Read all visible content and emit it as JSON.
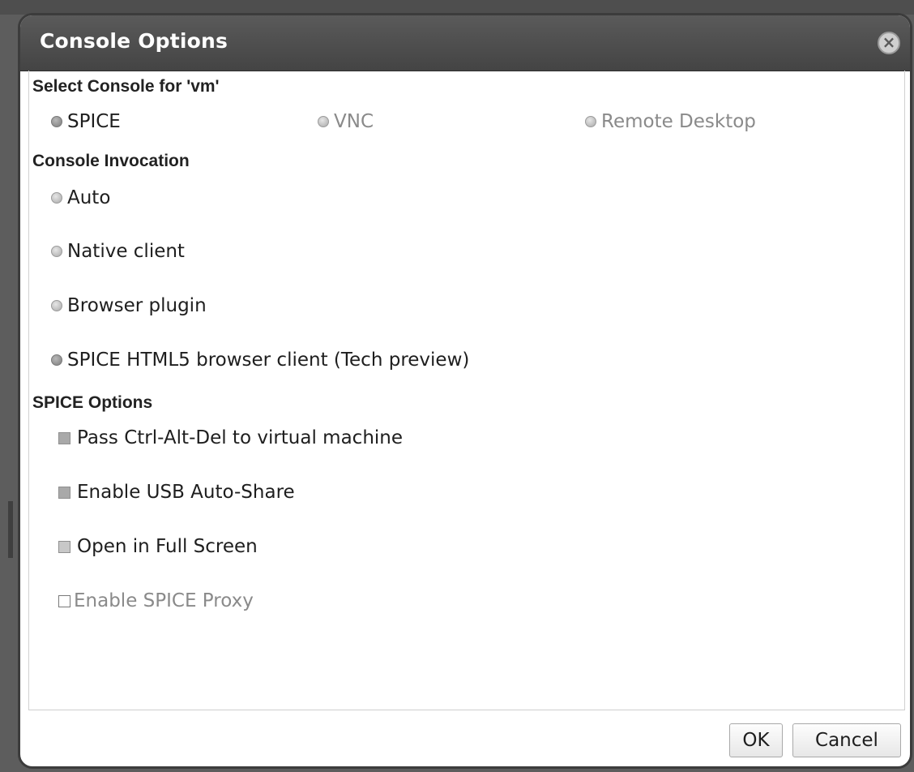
{
  "dialog": {
    "title": "Console Options",
    "close_icon": "close-circle-icon"
  },
  "console_select": {
    "label": "Select Console for 'vm'",
    "options": [
      {
        "label": "SPICE",
        "checked": true,
        "enabled": true
      },
      {
        "label": "VNC",
        "checked": false,
        "enabled": false
      },
      {
        "label": "Remote Desktop",
        "checked": false,
        "enabled": false
      }
    ]
  },
  "invocation": {
    "label": "Console Invocation",
    "options": [
      {
        "label": "Auto",
        "checked": false
      },
      {
        "label": "Native client",
        "checked": false
      },
      {
        "label": "Browser plugin",
        "checked": false
      },
      {
        "label": "SPICE HTML5 browser client (Tech preview)",
        "checked": true
      }
    ]
  },
  "spice_options": {
    "label": "SPICE Options",
    "options": [
      {
        "label": "Pass Ctrl-Alt-Del to virtual machine",
        "checked": true,
        "enabled": true
      },
      {
        "label": "Enable USB Auto-Share",
        "checked": true,
        "enabled": true
      },
      {
        "label": "Open in Full Screen",
        "checked": false,
        "enabled": true
      },
      {
        "label": "Enable SPICE Proxy",
        "checked": false,
        "enabled": false
      }
    ]
  },
  "footer": {
    "ok_label": "OK",
    "cancel_label": "Cancel"
  }
}
